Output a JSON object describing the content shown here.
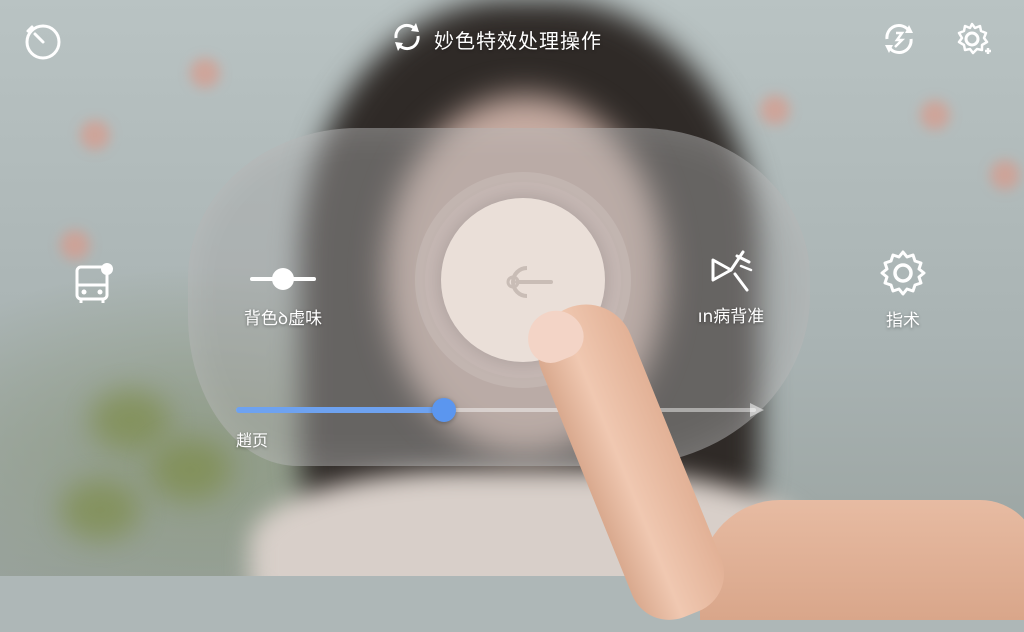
{
  "header": {
    "title": "妙色特效处理操作",
    "title_icon": "refresh-arrows-icon",
    "left_icon": "timer-icon",
    "right_icons": [
      "rotate-effect-icon",
      "settings-plus-icon"
    ]
  },
  "controls": {
    "left_icon": {
      "icon": "bus-icon"
    },
    "blur_bg": {
      "label": "背色ꝺ虚味",
      "icon": "mini-slider-icon"
    },
    "dial": {
      "icon": "lens-pointer-icon"
    },
    "beauty": {
      "label": "ın病背准",
      "icon": "magic-wand-icon"
    },
    "settings": {
      "label": "指术",
      "icon": "gear-icon"
    }
  },
  "slider": {
    "label": "趙页",
    "value": 0.4,
    "fill_color": "#6ea2f0",
    "knob_color": "#5b96ef"
  },
  "colors": {
    "accent": "#5b96ef",
    "panel": "rgba(170,170,170,0.45)"
  }
}
